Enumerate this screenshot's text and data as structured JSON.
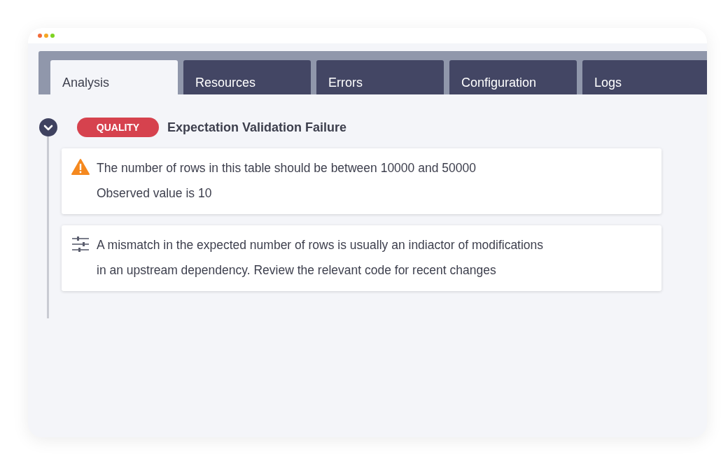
{
  "tabs": [
    {
      "label": "Analysis",
      "selected": true
    },
    {
      "label": "Resources",
      "selected": false
    },
    {
      "label": "Errors",
      "selected": false
    },
    {
      "label": "Configuration",
      "selected": false
    },
    {
      "label": "Logs",
      "selected": false
    }
  ],
  "event": {
    "expanded": true,
    "badge": "QUALITY",
    "title": "Expectation Validation Failure",
    "cards": [
      {
        "kind": "warning",
        "lines": [
          "The number of rows in this table should be between 10000 and 50000",
          "Observed value is 10"
        ]
      },
      {
        "kind": "hint",
        "lines": [
          "A mismatch in the expected number of rows is usually an indiactor of modifications",
          "in an upstream dependency. Review the relevant code for recent changes"
        ]
      }
    ]
  }
}
